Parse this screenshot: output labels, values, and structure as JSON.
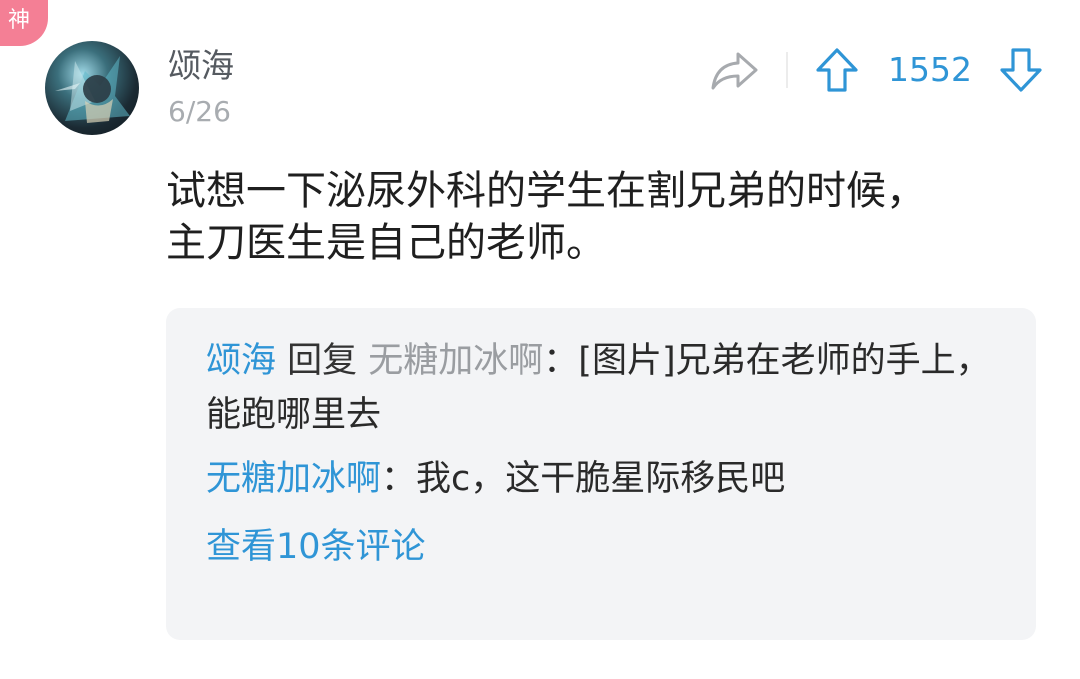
{
  "badge": {
    "label": "神"
  },
  "comment": {
    "username": "颂海",
    "date": "6/26",
    "body_line1": "试想一下泌尿外科的学生在割兄弟的时候，",
    "body_line2": "主刀医生是自己的老师。",
    "vote_count": "1552"
  },
  "icons": {
    "share": "share-icon",
    "upvote": "arrow-up-icon",
    "downvote": "arrow-down-icon",
    "avatar": "avatar-image"
  },
  "replies": [
    {
      "author": "颂海",
      "verb": " 回复 ",
      "target": "无糖加冰啊",
      "text": "：[图片]兄弟在老师的手上，能跑哪里去"
    },
    {
      "author": "无糖加冰啊",
      "text": "：我c，这干脆星际移民吧"
    }
  ],
  "view_more_label": "查看10条评论",
  "colors": {
    "accent": "#2f95d6",
    "badge": "#f47f95",
    "reply_bg": "#f3f4f6",
    "muted": "#a8acb0"
  }
}
